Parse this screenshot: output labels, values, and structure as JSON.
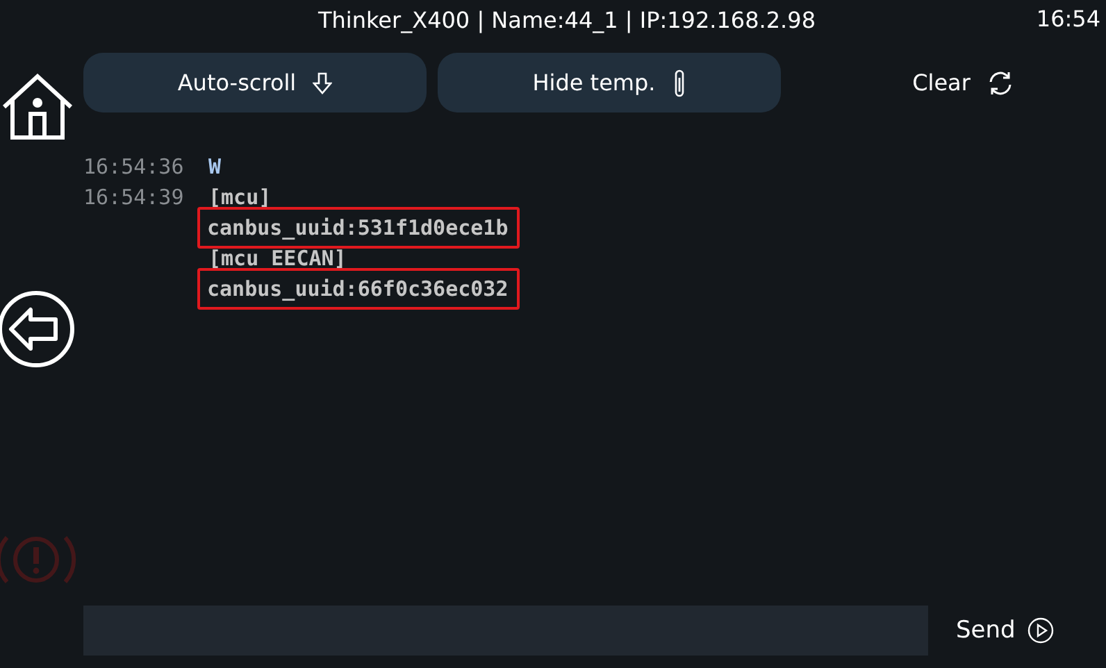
{
  "status_bar": {
    "title": "Thinker_X400 | Name:44_1 | IP:192.168.2.98",
    "time": "16:54"
  },
  "sidebar": {
    "items": [
      {
        "kind": "home"
      },
      {
        "kind": "back"
      },
      {
        "kind": "emergency",
        "disabled": true
      }
    ]
  },
  "toolbar": {
    "buttons": [
      {
        "label": "Auto-scroll",
        "kind": "autoscroll",
        "filled": true
      },
      {
        "label": "Hide temp.",
        "kind": "temperature",
        "filled": true
      },
      {
        "label": "Clear",
        "kind": "clear",
        "filled": false
      }
    ]
  },
  "console": {
    "lines": [
      {
        "time": "16:54:36",
        "text": "W",
        "kind": "command",
        "highlighted": false
      },
      {
        "time": "16:54:39",
        "text": "[mcu]",
        "kind": "response",
        "highlighted": false
      },
      {
        "text": "canbus_uuid:531f1d0ece1b",
        "kind": "response",
        "highlighted": true
      },
      {
        "text": "[mcu EECAN]",
        "kind": "response",
        "highlighted": false
      },
      {
        "text": "canbus_uuid:66f0c36ec032",
        "kind": "response",
        "highlighted": true
      }
    ]
  },
  "send_button": {
    "label": "Send"
  }
}
